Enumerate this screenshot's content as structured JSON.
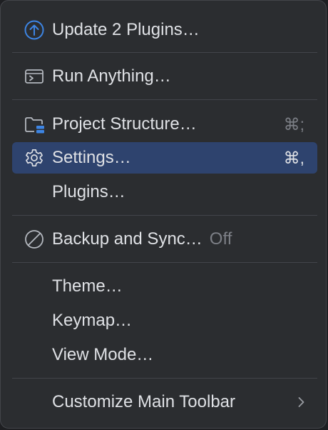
{
  "menu": {
    "update_plugins": {
      "label": "Update 2 Plugins…",
      "icon": "arrow-up-circle-icon"
    },
    "run_anything": {
      "label": "Run Anything…",
      "icon": "terminal-window-icon"
    },
    "project_structure": {
      "label": "Project Structure…",
      "shortcut": "⌘;",
      "icon": "folder-settings-icon"
    },
    "settings": {
      "label": "Settings…",
      "shortcut": "⌘,",
      "icon": "gear-icon",
      "selected": true
    },
    "plugins": {
      "label": "Plugins…"
    },
    "backup_sync": {
      "label": "Backup and Sync…",
      "status": "Off",
      "icon": "disabled-circle-icon"
    },
    "theme": {
      "label": "Theme…"
    },
    "keymap": {
      "label": "Keymap…"
    },
    "view_mode": {
      "label": "View Mode…"
    },
    "customize_toolbar": {
      "label": "Customize Main Toolbar",
      "icon": "chevron-right-icon"
    }
  },
  "colors": {
    "background": "#2b2d30",
    "border": "#43454a",
    "selected": "#2e436e",
    "accent": "#3d85e4",
    "text": "#dfe1e5",
    "muted": "#7c7f86"
  }
}
